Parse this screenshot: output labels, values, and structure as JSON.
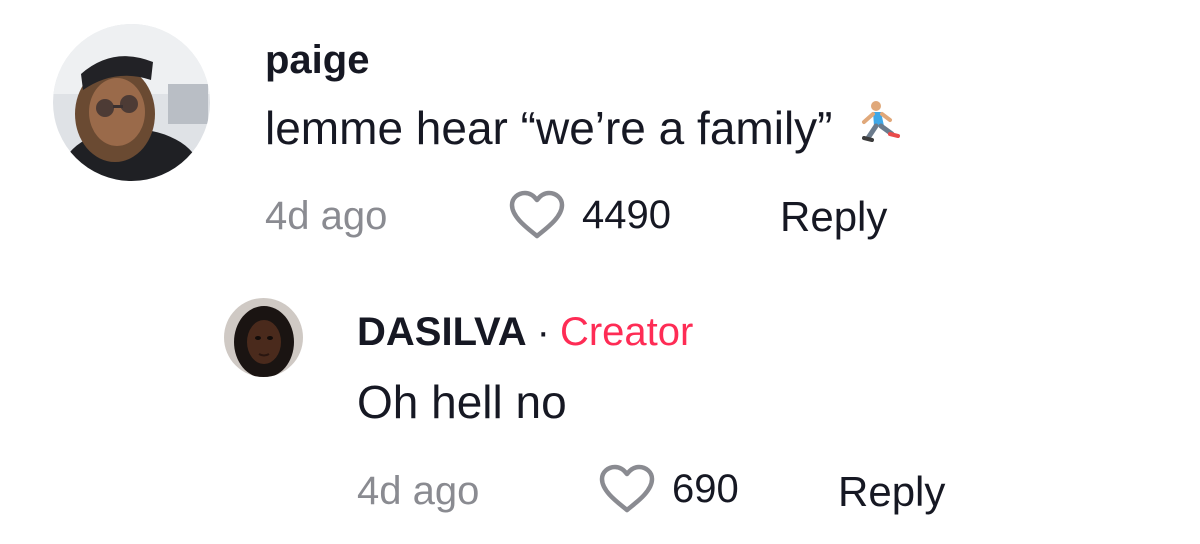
{
  "comments": [
    {
      "username": "paige",
      "text": "lemme hear “we’re a family”",
      "emoji": "running-man-emoji",
      "time": "4d ago",
      "likes": "4490",
      "reply_label": "Reply"
    }
  ],
  "replies": [
    {
      "username": "DASILVA",
      "separator": "·",
      "badge": "Creator",
      "text": "Oh hell no",
      "time": "4d ago",
      "likes": "690",
      "reply_label": "Reply"
    }
  ],
  "colors": {
    "text_primary": "#161823",
    "text_secondary": "#8a8b91",
    "creator_accent": "#fe2c55",
    "heart_outline": "#8a8b91"
  },
  "icons": [
    "heart-outline-icon",
    "running-man-emoji"
  ]
}
